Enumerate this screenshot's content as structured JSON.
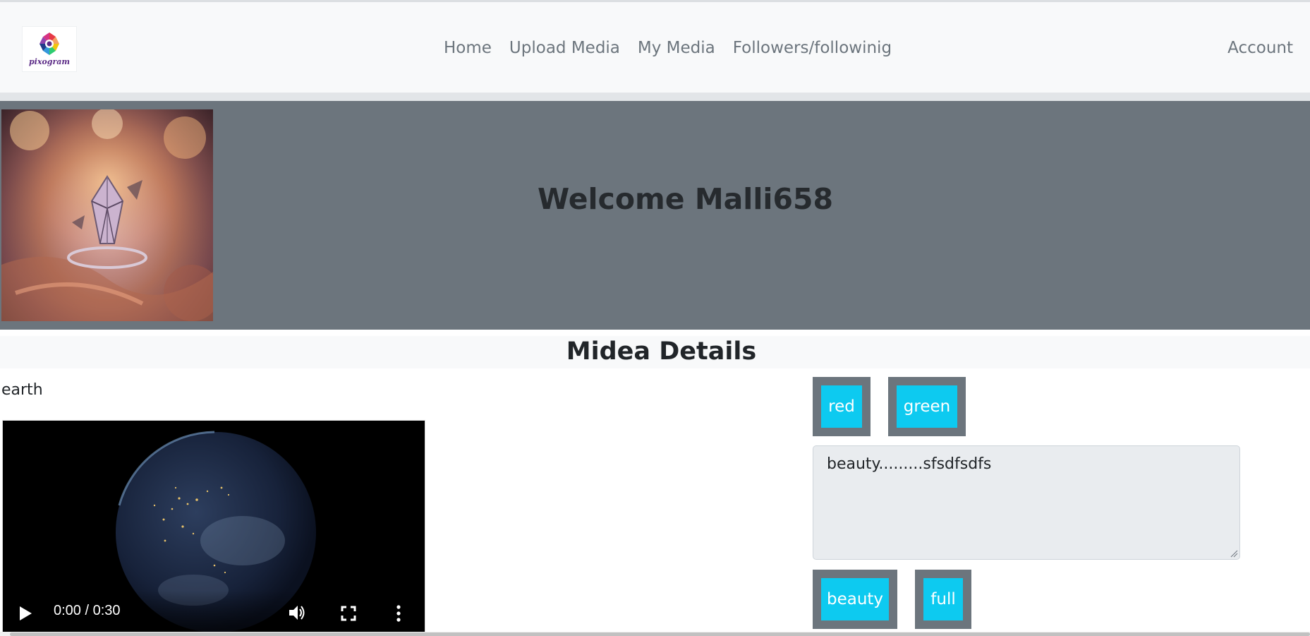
{
  "brand": {
    "logo_text": "pixogram"
  },
  "nav": {
    "links": [
      "Home",
      "Upload Media",
      "My Media",
      "Followers/followinig"
    ],
    "account": "Account"
  },
  "hero": {
    "title": "Welcome Malli658"
  },
  "details": {
    "heading": "Midea Details",
    "media_name": "earth",
    "video": {
      "time": "0:00 / 0:30"
    },
    "tags_top": [
      "red",
      "green"
    ],
    "description": "beauty.........sfsdfsdfs",
    "tags_bottom": [
      "beauty",
      "full"
    ]
  },
  "colors": {
    "navbar_bg": "#f8f9fa",
    "hero_bg": "#6c757d",
    "tag_button": "#0dcaf0",
    "textarea_bg": "#e9ecef"
  },
  "icons": [
    "play-icon",
    "volume-icon",
    "fullscreen-icon",
    "more-vert-icon",
    "pixogram-logo-icon"
  ]
}
